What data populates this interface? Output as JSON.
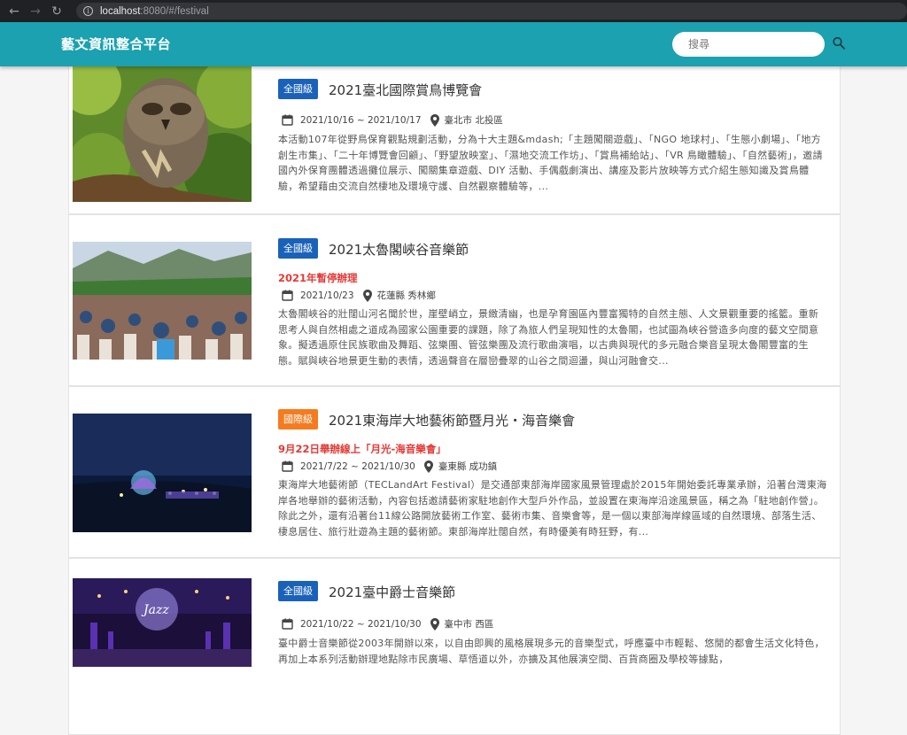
{
  "browser": {
    "url_host": "localhost",
    "url_path": ":8080/#/festival"
  },
  "header": {
    "brand": "藝文資訊整合平台",
    "search_placeholder": "搜尋"
  },
  "events": [
    {
      "badge": "全國級",
      "title": "2021臺北國際賞鳥博覽會",
      "notice": "",
      "date": "2021/10/16 ~ 2021/10/17",
      "location": "臺北市 北投區",
      "description": "本活動107年從野鳥保育觀點規劃活動，分為十大主題&mdash;「主題闖關遊戲」、「NGO 地球村」、「生態小劇場」、「地方創生市集」、「二十年博覽會回顧」、「野望放映室」、「濕地交流工作坊」、「賞鳥補給站」、「VR 鳥瞰體驗」、「自然藝術」，邀請國內外保育團體透過攤位展示、闖關集章遊戲、DIY 活動、手偶戲劇演出、講座及影片放映等方式介紹生態知識及賞鳥體驗，希望藉由交流自然棲地及環境守護、自然觀察體驗等，..."
    },
    {
      "badge": "全國級",
      "title": "2021太魯閣峽谷音樂節",
      "notice": "2021年暫停辦理",
      "date": "2021/10/23",
      "location": "花蓮縣 秀林鄉",
      "description": "太魯閣峽谷的壯闊山河名聞於世，崖壁峭立，景緻清幽，也是孕育園區內豐富獨特的自然主態、人文景觀重要的搖籃。重新思考人與自然相處之道成為國家公園重要的課題，除了為旅人們呈現知性的太魯閣，也試圖為峽谷營造多向度的藝文空間意象。擬透過原住民族歌曲及舞蹈、弦樂團、管弦樂團及流行歌曲演唱，以古典與現代的多元融合樂音呈現太魯閣豐富的生態。賦與峽谷地景更生動的表情，透過聲音在層巒疊翠的山谷之間迴盪，與山河融會交..."
    },
    {
      "badge": "國際級",
      "title": "2021東海岸大地藝術節暨月光・海音樂會",
      "notice": "9月22日舉辦線上「月光-海音樂會」",
      "date": "2021/7/22 ~ 2021/10/30",
      "location": "臺東縣 成功鎮",
      "description": "東海岸大地藝術節（TECLandArt Festival）是交通部東部海岸國家風景管理處於2015年開始委託專業承辦，沿著台灣東海岸各地舉辦的藝術活動，內容包括邀請藝術家駐地創作大型戶外作品，並設置在東海岸沿途風景區，稱之為「駐地創作營」。除此之外，還有沿著台11線公路開放藝術工作室、藝術市集、音樂會等，是一個以東部海岸線區域的自然環境、部落生活、棲息居住、旅行壯遊為主題的藝術節。東部海岸壯闊自然，有時優美有時狂野，有..."
    },
    {
      "badge": "全國級",
      "title": "2021臺中爵士音樂節",
      "notice": "",
      "date": "2021/10/22 ~ 2021/10/30",
      "location": "臺中市 西區",
      "description": "臺中爵士音樂節從2003年開辦以來，以自由即興的風格展現多元的音樂型式，呼應臺中市輕鬆、悠閒的都會生活文化特色，再加上本系列活動辦理地點除市民廣場、草悟道以外，亦擴及其他展演空間、百貨商圈及學校等據點，"
    }
  ]
}
